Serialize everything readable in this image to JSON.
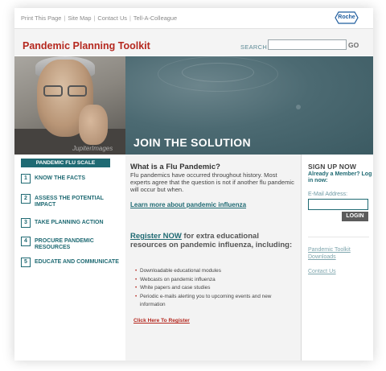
{
  "utility_nav": {
    "items": [
      "Print This Page",
      "Site Map",
      "Contact Us",
      "Tell-A-Colleague"
    ],
    "separator": "|"
  },
  "logo": {
    "text": "Roche"
  },
  "header": {
    "title": "Pandemic Planning Toolkit",
    "search_label": "SEARCH",
    "search_value": "",
    "go_label": "GO"
  },
  "hero": {
    "tagline": "JOIN THE SOLUTION",
    "photo_credit": "JupiterImages"
  },
  "flu_scale": {
    "header": "PANDEMIC FLU SCALE",
    "steps": [
      {
        "num": "1",
        "label": "KNOW THE FACTS"
      },
      {
        "num": "2",
        "label": "ASSESS THE POTENTIAL IMPACT"
      },
      {
        "num": "3",
        "label": "TAKE PLANNING ACTION"
      },
      {
        "num": "4",
        "label": "PROCURE PANDEMIC RESOURCES"
      },
      {
        "num": "5",
        "label": "EDUCATE AND COMMUNICATE"
      }
    ]
  },
  "main": {
    "heading": "What is a Flu Pandemic?",
    "body": "Flu pandemics have occurred throughout history. Most experts agree that the question is not if another flu pandemic will occur but when.",
    "learn_more": "Learn more about pandemic influenza",
    "register_link": "Register NOW",
    "register_text": " for extra educational resources on pandemic influenza, including:",
    "benefits": [
      "Downloadable educational modules",
      "Webcasts on pandemic influenza",
      "White papers and case studies",
      "Periodic e-mails alerting you to upcoming events and new information"
    ],
    "click_register": "Click Here To Register"
  },
  "sidebar": {
    "signup": "SIGN UP NOW",
    "member": "Already a Member? Log in now:",
    "email_label": "E-Mail Address:",
    "email_value": "",
    "login_label": "LOGIN",
    "downloads_link": "Pandemic Toolkit Downloads",
    "contact_link": "Contact Us"
  },
  "colors": {
    "brand_red": "#b5281f",
    "teal": "#1f6a73",
    "hero_bg": "#3f5e66"
  }
}
